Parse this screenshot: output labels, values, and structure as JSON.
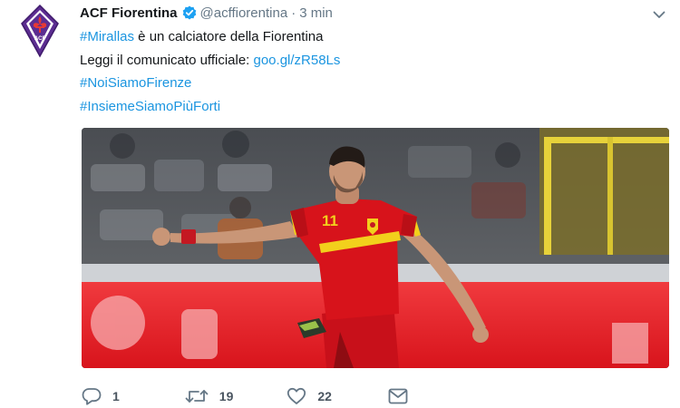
{
  "tweet": {
    "author_name": "ACF Fiorentina",
    "handle": "@acffiorentina",
    "separator": "·",
    "time": "3 min",
    "lines": [
      [
        {
          "text": "#Mirallas",
          "kind": "link"
        },
        {
          "text": " è un calciatore della Fiorentina",
          "kind": "plain"
        }
      ],
      [
        {
          "text": "Leggi il comunicato ufficiale: ",
          "kind": "plain"
        },
        {
          "text": "goo.gl/zR58Ls",
          "kind": "link"
        }
      ],
      [
        {
          "text": "#NoiSiamoFirenze",
          "kind": "link"
        }
      ],
      [
        {
          "text": "#InsiemeSiamoPiùForti",
          "kind": "link"
        }
      ]
    ],
    "media": {
      "jersey_number": "11",
      "colors": {
        "jersey": "#d7131b",
        "trim": "#f2d01c",
        "board": "#e8202a"
      }
    }
  },
  "actions": {
    "reply": {
      "icon": "reply-icon",
      "count": "1"
    },
    "retweet": {
      "icon": "retweet-icon",
      "count": "19"
    },
    "like": {
      "icon": "heart-icon",
      "count": "22"
    },
    "message": {
      "icon": "envelope-icon"
    }
  },
  "colors": {
    "link": "#1b95e0",
    "secondary_text": "#657786",
    "verified": "#1da1f2",
    "fiorentina_purple": "#5c2d91"
  }
}
